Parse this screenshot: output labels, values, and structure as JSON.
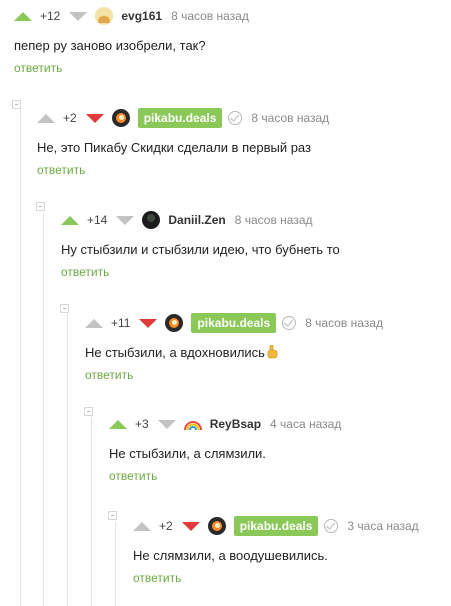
{
  "comments": [
    {
      "score": "+12",
      "username": "evg161",
      "time": "8 часов назад",
      "text": "пепер ру заново изобрели, так?",
      "reply_label": "ответить",
      "voted": "up"
    },
    {
      "score": "+2",
      "username": "pikabu.deals",
      "time": "8 часов назад",
      "text": "Не, это Пикабу Скидки сделали в первый раз",
      "reply_label": "ответить",
      "voted": "down"
    },
    {
      "score": "+14",
      "username": "Daniil.Zen",
      "time": "8 часов назад",
      "text": "Ну стыбзили и стыбзили идею, что бубнеть то",
      "reply_label": "ответить",
      "voted": "up"
    },
    {
      "score": "+11",
      "username": "pikabu.deals",
      "time": "8 часов назад",
      "text": "Не стыбзили, а вдохновились",
      "reply_label": "ответить",
      "voted": "down"
    },
    {
      "score": "+3",
      "username": "ReyBsap",
      "time": "4 часа назад",
      "text": "Не стыбзили, а слямзили.",
      "reply_label": "ответить",
      "voted": "up"
    },
    {
      "score": "+2",
      "username": "pikabu.deals",
      "time": "3 часа назад",
      "text": "Не слямзили, а воодушевились.",
      "reply_label": "ответить",
      "voted": "down"
    }
  ],
  "icons": {
    "upvote": "upvote-arrow-icon",
    "downvote": "downvote-arrow-icon",
    "verified": "verified-check-icon",
    "collapse": "collapse-thread-icon",
    "emoji": "raised-finger-emoji-icon"
  },
  "colors": {
    "accent_green": "#8ac858",
    "reply_green": "#6da842",
    "downvote_red": "#e03a3a",
    "meta_gray": "#8a8a8a"
  }
}
